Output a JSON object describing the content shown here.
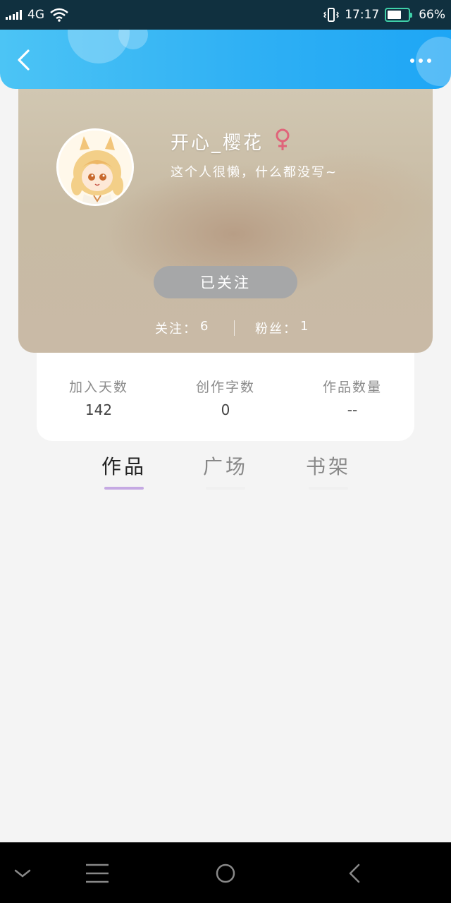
{
  "status_bar": {
    "network": "4G",
    "time": "17:17",
    "battery": "66%"
  },
  "profile": {
    "nickname": "开心_樱花",
    "gender_symbol": "♀",
    "bio": "这个人很懒，什么都没写~",
    "follow_button": "已关注",
    "following_label": "关注：",
    "following_count": "6",
    "fans_label": "粉丝：",
    "fans_count": "1"
  },
  "stats": [
    {
      "label": "加入天数",
      "value": "142"
    },
    {
      "label": "创作字数",
      "value": "0"
    },
    {
      "label": "作品数量",
      "value": "--"
    }
  ],
  "tabs": [
    {
      "label": "作品"
    },
    {
      "label": "广场"
    },
    {
      "label": "书架"
    }
  ],
  "colors": {
    "header_blue": "#2fb0f4",
    "active_tab_underline": "#c5a9e3",
    "follow_button_bg": "#a6a7a8",
    "female_icon": "#e0647a"
  }
}
